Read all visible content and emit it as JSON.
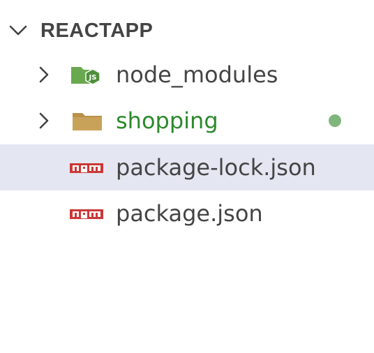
{
  "explorer": {
    "root_folder": {
      "name": "REACTAPP",
      "expanded": true
    },
    "items": [
      {
        "name": "node_modules",
        "type": "folder",
        "icon": "nodejs-folder-icon",
        "expanded": false,
        "modified": false
      },
      {
        "name": "shopping",
        "type": "folder",
        "icon": "folder-icon",
        "expanded": false,
        "modified": true,
        "status_color": "#80b67e"
      },
      {
        "name": "package-lock.json",
        "type": "file",
        "icon": "npm-icon",
        "selected": true
      },
      {
        "name": "package.json",
        "type": "file",
        "icon": "npm-icon",
        "selected": false
      }
    ],
    "colors": {
      "text": "#444444",
      "modified_text": "#2a8a2a",
      "selection_bg": "#e4e6f1",
      "npm_red": "#cb3837",
      "folder_brown": "#b8924a",
      "node_green": "#6aa84f"
    }
  }
}
